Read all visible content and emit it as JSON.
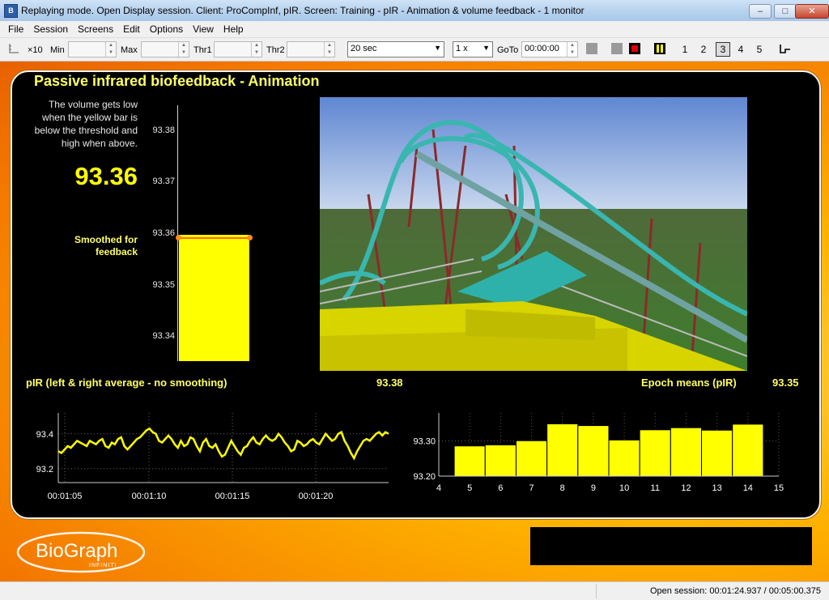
{
  "window": {
    "app_icon": "biograph-icon",
    "title": "Replaying mode. Open Display session. Client: ProCompInf, pIR. Screen: Training - pIR - Animation & volume feedback - 1 monitor",
    "controls": {
      "minimize": "–",
      "maximize": "□",
      "close": "✕"
    }
  },
  "menu": [
    "File",
    "Session",
    "Screens",
    "Edit",
    "Options",
    "View",
    "Help"
  ],
  "toolbar": {
    "scale_icon": "axis-icon",
    "x_label": "×10",
    "min_label": "Min",
    "min_value": "",
    "max_label": "Max",
    "max_value": "",
    "thr1_label": "Thr1",
    "thr1_value": "",
    "thr2_label": "Thr2",
    "thr2_value": "",
    "duration_value": "20 sec",
    "speed_value": "1 x",
    "goto_label": "GoTo",
    "goto_value": "00:00:00",
    "screen_numbers": [
      "1",
      "2",
      "3",
      "4",
      "5"
    ],
    "selected_screen": "3"
  },
  "panel": {
    "title": "Passive infrared biofeedback - Animation",
    "instructions": [
      "The volume gets low",
      "when the yellow bar is",
      "below the threshold and",
      "high when above."
    ],
    "big_value": "93.36",
    "smoothed_label": [
      "Smoothed for",
      "feedback"
    ],
    "bar_meter": {
      "ticks": [
        "93.38",
        "93.37",
        "93.36",
        "93.35",
        "93.34"
      ],
      "value": 93.36,
      "threshold": 93.36
    },
    "pir_label": "pIR (left & right average - no smoothing)",
    "pir_value": "93.38",
    "epoch_label": "Epoch means (pIR)",
    "epoch_value": "93.35"
  },
  "colors": {
    "accent": "#ffff00",
    "label": "#ffff66",
    "threshold": "#ff6a00",
    "panel_bg": "#000000"
  },
  "chart_data": [
    {
      "type": "line",
      "title": "",
      "xlabel": "",
      "ylabel": "",
      "x_ticks": [
        "00:01:05",
        "00:01:10",
        "00:01:15",
        "00:01:20"
      ],
      "y_ticks": [
        "93.4",
        "93.2"
      ],
      "ylim": [
        93.12,
        93.52
      ],
      "grid": true,
      "series": [
        {
          "values": [
            93.3,
            93.29,
            93.31,
            93.33,
            93.32,
            93.34,
            93.36,
            93.35,
            93.34,
            93.33,
            93.36,
            93.35,
            93.34,
            93.36,
            93.37,
            93.33,
            93.32,
            93.35,
            93.34,
            93.37,
            93.38,
            93.33,
            93.31,
            93.33,
            93.35,
            93.37,
            93.38,
            93.4,
            93.42,
            93.43,
            93.41,
            93.4,
            93.36,
            93.35,
            93.37,
            93.39,
            93.37,
            93.34,
            93.32,
            93.36,
            93.33,
            93.34,
            93.38,
            93.37,
            93.33,
            93.3,
            93.35,
            93.37,
            93.33,
            93.32,
            93.34,
            93.3,
            93.27,
            93.28,
            93.32,
            93.36,
            93.33,
            93.3,
            93.28,
            93.32,
            93.33,
            93.36,
            93.38,
            93.35,
            93.34,
            93.37,
            93.39,
            93.37,
            93.36,
            93.37,
            93.4,
            93.38,
            93.35,
            93.33,
            93.3,
            93.31,
            93.36,
            93.35,
            93.33,
            93.34,
            93.36,
            93.37,
            93.35,
            93.34,
            93.37,
            93.4,
            93.38,
            93.36,
            93.37,
            93.4,
            93.41,
            93.36,
            93.33,
            93.29,
            93.26,
            93.3,
            93.33,
            93.36,
            93.37,
            93.36,
            93.38,
            93.4,
            93.41,
            93.39,
            93.41,
            93.4
          ]
        }
      ]
    },
    {
      "type": "bar",
      "title": "",
      "xlabel": "",
      "ylabel": "",
      "x_ticks": [
        "4",
        "5",
        "6",
        "7",
        "8",
        "9",
        "10",
        "11",
        "12",
        "13",
        "14",
        "15"
      ],
      "y_ticks": [
        "93.30",
        "93.20"
      ],
      "ylim": [
        93.2,
        93.38
      ],
      "grid": true,
      "categories": [
        "5",
        "6",
        "7",
        "8",
        "9",
        "10",
        "11",
        "12",
        "13",
        "14"
      ],
      "values": [
        93.286,
        93.289,
        93.301,
        93.349,
        93.344,
        93.303,
        93.332,
        93.338,
        93.331,
        93.348
      ]
    }
  ],
  "logo": {
    "text": "BioGraph",
    "sub": "INFINITI"
  },
  "status": {
    "text": "Open session: 00:01:24.937 / 00:05:00.375"
  }
}
